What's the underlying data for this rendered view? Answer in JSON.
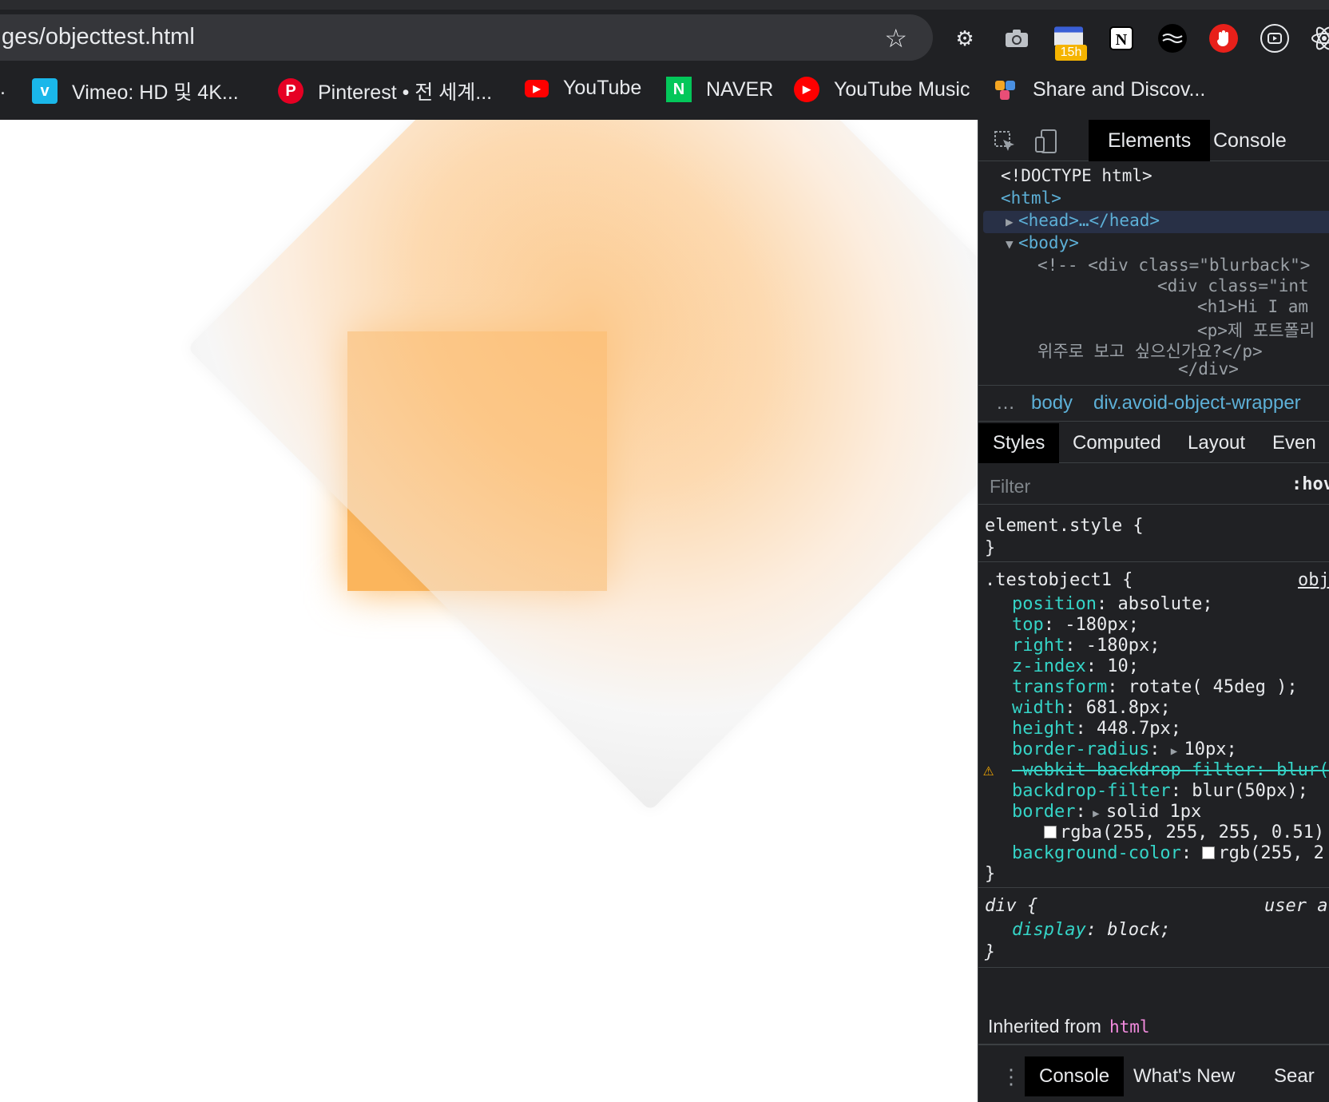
{
  "browser": {
    "url": "ges/objecttest.html",
    "extension_badge": "15h",
    "bookmarks": [
      {
        "label": "Vimeo: HD 및 4K...",
        "icon": "vimeo-icon",
        "color": "#1ab7ea",
        "glyph": "v"
      },
      {
        "label": "Pinterest • 전 세계...",
        "icon": "pinterest-icon",
        "color": "#e60023",
        "glyph": "P"
      },
      {
        "label": "YouTube",
        "icon": "youtube-icon",
        "color": "#ff0000",
        "glyph": "▶"
      },
      {
        "label": "NAVER",
        "icon": "naver-icon",
        "color": "#03c75a",
        "glyph": "N"
      },
      {
        "label": "YouTube Music",
        "icon": "youtube-music-icon",
        "color": "#ff0000",
        "glyph": "▶"
      },
      {
        "label": "Share and Discov...",
        "icon": "share-icon",
        "color": "#f5a623",
        "glyph": "◆"
      }
    ]
  },
  "page": {
    "accent": "#fbb55c"
  },
  "devtools": {
    "tabs": [
      "Elements",
      "Console"
    ],
    "dom": {
      "doctype": "<!DOCTYPE html>",
      "html_open": "<html>",
      "head": "<head>…</head>",
      "body_open": "<body>",
      "comment1": "<!-- <div class=\"blurback\">",
      "line2": "<div class=\"int",
      "line3": "<h1>Hi I am",
      "line4": "<p>제 포트폴리",
      "line5": "위주로 보고 싶으신가요?</p>",
      "line6": "</div>"
    },
    "breadcrumbs": [
      "…",
      "body",
      "div.avoid-object-wrapper"
    ],
    "subtabs": [
      "Styles",
      "Computed",
      "Layout",
      "Even"
    ],
    "filter_placeholder": "Filter",
    "hov": ":hov",
    "element_style": "element.style {",
    "close_brace": "}",
    "rule1": {
      "selector": ".testobject1 {",
      "source": "obj",
      "props": [
        {
          "name": "position",
          "value": "absolute;"
        },
        {
          "name": "top",
          "value": "-180px;"
        },
        {
          "name": "right",
          "value": "-180px;"
        },
        {
          "name": "z-index",
          "value": "10;"
        },
        {
          "name": "transform",
          "value": "rotate( 45deg );"
        },
        {
          "name": "width",
          "value": "681.8px;"
        },
        {
          "name": "height",
          "value": "448.7px;"
        },
        {
          "name": "border-radius",
          "value": "10px;"
        }
      ],
      "struck": "-webkit-backdrop-filter: blur(",
      "props2": [
        {
          "name": "backdrop-filter",
          "value": "blur(50px);"
        },
        {
          "name": "border",
          "value": "solid 1px"
        }
      ],
      "border_color": "rgba(255, 255, 255, 0.51)",
      "bg_prop": "background-color",
      "bg_value": "rgb(255, 2"
    },
    "rule2": {
      "selector": "div {",
      "source": "user a",
      "prop": "display",
      "value": "block;"
    },
    "inherited_label": "Inherited from",
    "inherited_tag": "html",
    "drawer_tabs": [
      "Console",
      "What's New",
      "Sear"
    ]
  }
}
